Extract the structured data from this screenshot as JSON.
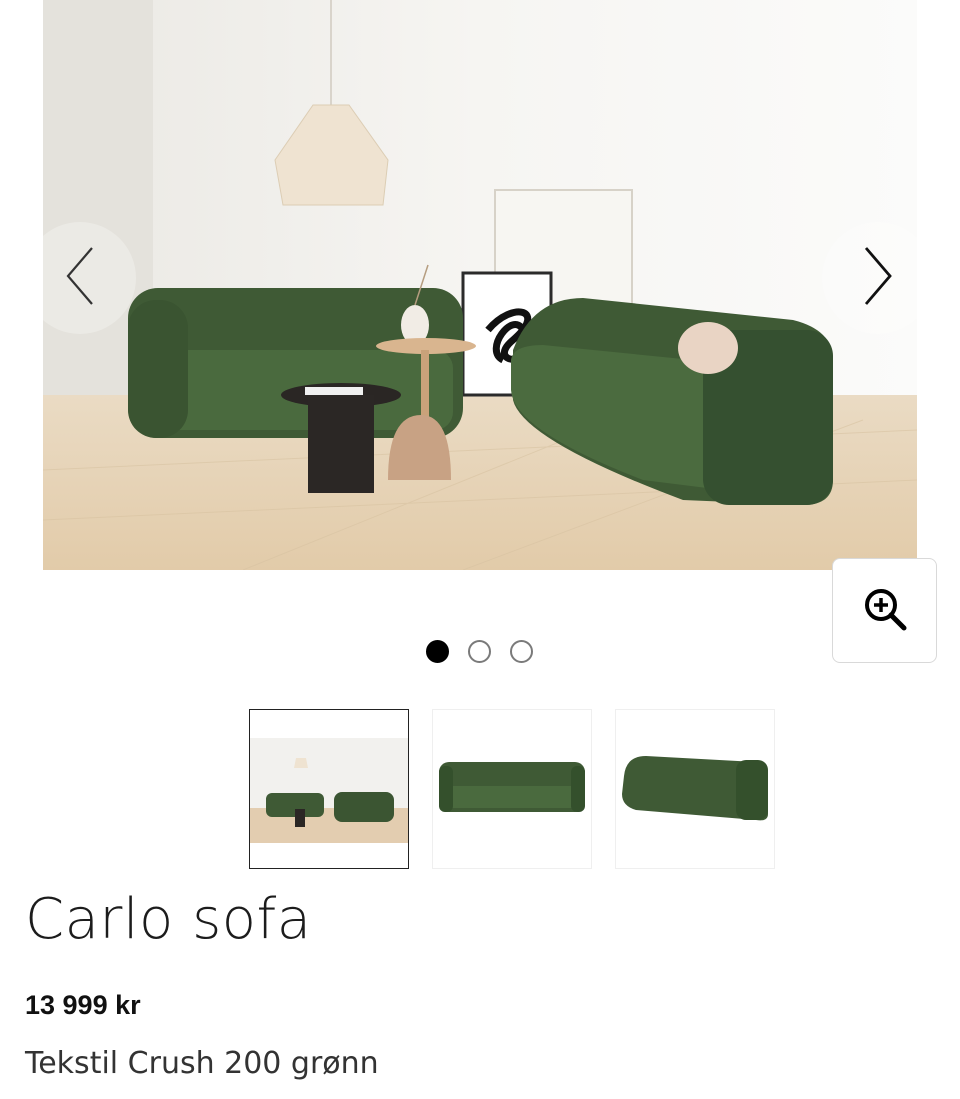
{
  "gallery": {
    "hero_alt": "Carlo sofa",
    "prev_icon": "chevron-left-icon",
    "next_icon": "chevron-right-icon",
    "zoom_icon": "zoom-in-icon",
    "dots": [
      {
        "active": true
      },
      {
        "active": false
      },
      {
        "active": false
      }
    ],
    "thumbnails": [
      {
        "name": "thumbnail-room",
        "selected": true
      },
      {
        "name": "thumbnail-front",
        "selected": false
      },
      {
        "name": "thumbnail-angle",
        "selected": false
      }
    ]
  },
  "product": {
    "title": "Carlo sofa",
    "price": "13 999 kr",
    "variant": "Tekstil Crush 200 grønn"
  },
  "colors": {
    "sofa_green": "#3f5a35",
    "floor": "#e6d3b6",
    "wall": "#f2f1ee",
    "active_dot": "#000000"
  }
}
